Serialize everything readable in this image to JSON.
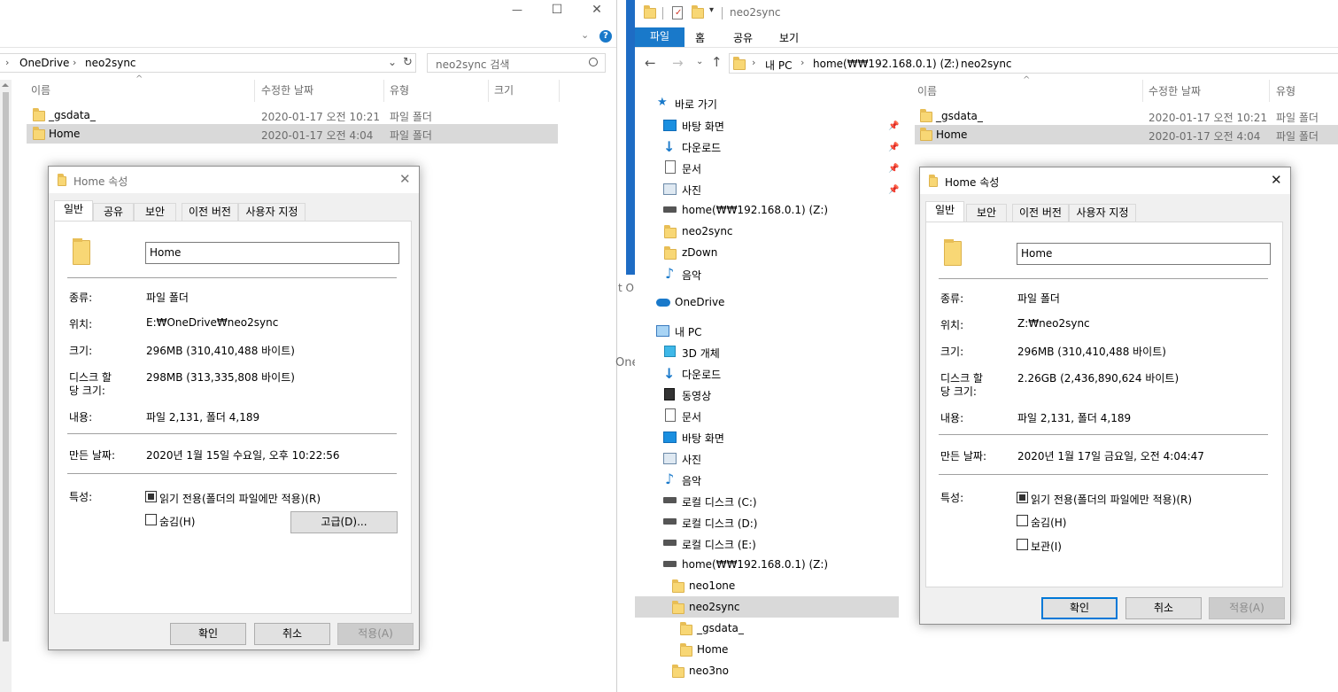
{
  "left": {
    "window_controls": {
      "minimize": "—",
      "maximize": "☐",
      "close": "✕"
    },
    "breadcrumb": {
      "seg1": "OneDrive",
      "seg2": "neo2sync"
    },
    "search_placeholder": "neo2sync 검색",
    "columns": {
      "name": "이름",
      "modified": "수정한 날짜",
      "type": "유형",
      "size": "크기"
    },
    "rows": [
      {
        "name": "_gsdata_",
        "modified": "2020-01-17 오전 10:21",
        "type": "파일 폴더"
      },
      {
        "name": "Home",
        "modified": "2020-01-17 오전 4:04",
        "type": "파일 폴더"
      }
    ],
    "dialog": {
      "title": "Home 속성",
      "tabs": [
        "일반",
        "공유",
        "보안",
        "이전 버전",
        "사용자 지정"
      ],
      "name_value": "Home",
      "fields": {
        "type_label": "종류:",
        "type_value": "파일 폴더",
        "location_label": "위치:",
        "location_value": "E:₩OneDrive₩neo2sync",
        "size_label": "크기:",
        "size_value": "296MB (310,410,488 바이트)",
        "disk_label_1": "디스크 할",
        "disk_label_2": "당 크기:",
        "disk_value": "298MB (313,335,808 바이트)",
        "contents_label": "내용:",
        "contents_value": "파일 2,131, 폴더 4,189",
        "created_label": "만든 날짜:",
        "created_value": "2020년 1월 15일 수요일, 오후 10:22:56",
        "attr_label": "특성:",
        "readonly": "읽기 전용(폴더의 파일에만 적용)(R)",
        "hidden": "숨김(H)",
        "advanced": "고급(D)..."
      },
      "buttons": {
        "ok": "확인",
        "cancel": "취소",
        "apply": "적용(A)"
      }
    }
  },
  "right": {
    "title": "neo2sync",
    "ribbon": {
      "file": "파일",
      "home": "홈",
      "share": "공유",
      "view": "보기"
    },
    "address": {
      "seg1": "내 PC",
      "seg2": "home(₩₩192.168.0.1) (Z:)",
      "seg3": "neo2sync"
    },
    "nav": {
      "quick_access": "바로 가기",
      "quick_items": [
        "바탕 화면",
        "다운로드",
        "문서",
        "사진",
        "home(₩₩192.168.0.1) (Z:)",
        "neo2sync",
        "zDown",
        "음악"
      ],
      "onedrive": "OneDrive",
      "this_pc": "내 PC",
      "pc_items": [
        "3D 개체",
        "다운로드",
        "동영상",
        "문서",
        "바탕 화면",
        "사진",
        "음악",
        "로컬 디스크 (C:)",
        "로컬 디스크 (D:)",
        "로컬 디스크 (E:)",
        "home(₩₩192.168.0.1) (Z:)"
      ],
      "tree": [
        "neo1one",
        "neo2sync",
        "_gsdata_",
        "Home",
        "neo3no"
      ]
    },
    "columns": {
      "name": "이름",
      "modified": "수정한 날짜",
      "type": "유형"
    },
    "rows": [
      {
        "name": "_gsdata_",
        "modified": "2020-01-17 오전 10:21",
        "type": "파일 폴더"
      },
      {
        "name": "Home",
        "modified": "2020-01-17 오전 4:04",
        "type": "파일 폴더"
      }
    ],
    "dialog": {
      "title": "Home 속성",
      "tabs": [
        "일반",
        "보안",
        "이전 버전",
        "사용자 지정"
      ],
      "name_value": "Home",
      "fields": {
        "type_label": "종류:",
        "type_value": "파일 폴더",
        "location_label": "위치:",
        "location_value": "Z:₩neo2sync",
        "size_label": "크기:",
        "size_value": "296MB (310,410,488 바이트)",
        "disk_label_1": "디스크 할",
        "disk_label_2": "당 크기:",
        "disk_value": "2.26GB (2,436,890,624 바이트)",
        "contents_label": "내용:",
        "contents_value": "파일 2,131, 폴더 4,189",
        "created_label": "만든 날짜:",
        "created_value": "2020년 1월 17일 금요일, 오전 4:04:47",
        "attr_label": "특성:",
        "readonly": "읽기 전용(폴더의 파일에만 적용)(R)",
        "hidden": "숨김(H)",
        "archive": "보관(I)"
      },
      "buttons": {
        "ok": "확인",
        "cancel": "취소",
        "apply": "적용(A)"
      }
    }
  },
  "background_fragments": {
    "frag1": "t Or",
    "frag2": "One"
  },
  "colors": {
    "accent": "#0078d7",
    "selection": "#d9d9d9",
    "folder": "#f8d775"
  }
}
